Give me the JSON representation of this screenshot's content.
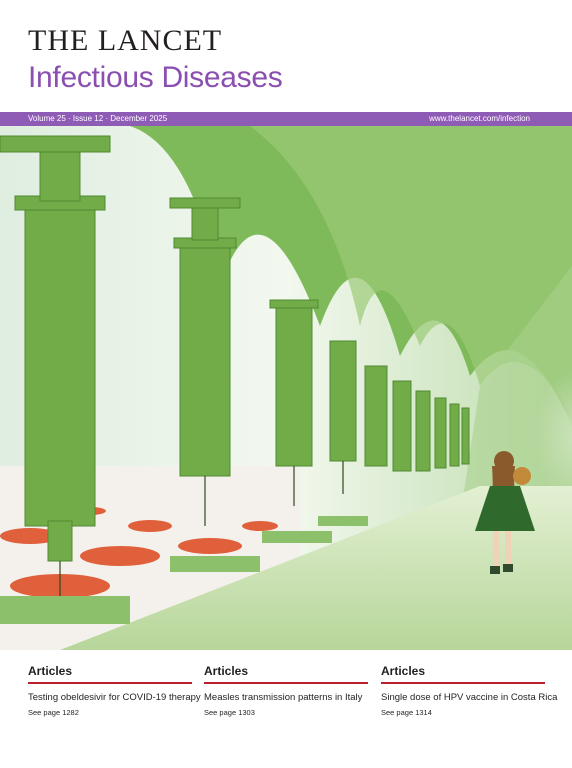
{
  "masthead": {
    "title": "THE LANCET",
    "subtitle": "Infectious Diseases"
  },
  "issue_bar": {
    "issue": "Volume 25 · Issue 12 · December 2025",
    "url": "www.thelancet.com/infection"
  },
  "cover_image": {
    "description_icon": "syringe-arcade-illustration-icon"
  },
  "articles": [
    {
      "kicker": "Articles",
      "headline": "Testing obeldesivir for COVID-19 therapy",
      "page": "See page 1282"
    },
    {
      "kicker": "Articles",
      "headline": "Measles transmission patterns in Italy",
      "page": "See page 1303"
    },
    {
      "kicker": "Articles",
      "headline": "Single dose of HPV vaccine in Costa Rica",
      "page": "See page 1314"
    }
  ],
  "colors": {
    "accent_purple": "#8e5bb5",
    "title_purple": "#8a4fb0",
    "rule_red": "#b8202b",
    "art_green": "#6fae4a"
  }
}
